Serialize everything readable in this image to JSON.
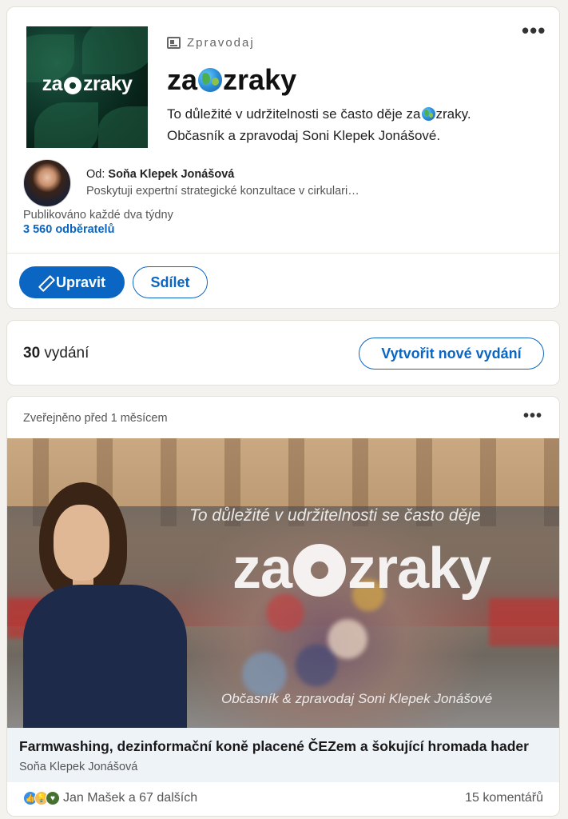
{
  "newsletter": {
    "cover_logo_left": "za",
    "cover_logo_right": "zraky",
    "kicker": "Zpravodaj",
    "title_left": "za",
    "title_right": "zraky",
    "description_line1_left": "To důležité v udržitelnosti se často děje za",
    "description_line1_right": "zraky.",
    "description_line2": "Občasník a zpravodaj Soni Klepek Jonášové.",
    "author_prefix": "Od:",
    "author_name": "Soňa Klepek Jonášová",
    "author_bio": "Poskytuji expertní strategické konzultace v cirkulari…",
    "frequency": "Publikováno každé dva týdny",
    "subscribers": "3 560 odběratelů",
    "edit_label": "Upravit",
    "share_label": "Sdílet"
  },
  "editions": {
    "count": "30",
    "count_suffix": "vydání",
    "new_edition_label": "Vytvořit nové vydání"
  },
  "article": {
    "published": "Zveřejněno před 1 měsícem",
    "image_tagline": "To důležité v udržitelnosti se často děje",
    "image_logo_left": "za",
    "image_logo_right": "zraky",
    "image_footer": "Občasník & zpravodaj Soni Klepek Jonášové",
    "title": "Farmwashing, dezinformační koně placené ČEZem a šokující hromada hader",
    "author": "Soňa Klepek Jonášová",
    "reactions_text": "Jan Mašek a 67 dalších",
    "comments": "15 komentářů"
  },
  "icons": {
    "more": "more-horizontal-icon",
    "newsletter": "newsletter-icon",
    "edit": "pencil-icon",
    "globe": "globe-icon",
    "reactions": [
      "like-icon",
      "insightful-icon",
      "support-icon"
    ]
  },
  "colors": {
    "accent": "#0a66c2",
    "background": "#f4f2ee",
    "card": "#ffffff"
  }
}
